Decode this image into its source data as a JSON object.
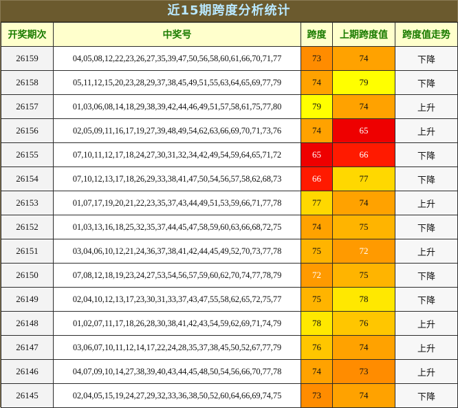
{
  "title": "近15期跨度分析统计",
  "headers": {
    "issue": "开奖期次",
    "numbers": "中奖号",
    "span": "跨度",
    "prev_span": "上期跨度值",
    "trend": "跨度值走势"
  },
  "colors": {
    "span_65": "#ee0000",
    "span_66": "#ff1a00",
    "span_72": "#ff9a00",
    "span_73": "#ff8c00",
    "span_74": "#ffa200",
    "span_75": "#ffb400",
    "span_76": "#ffc600",
    "span_77": "#ffd800",
    "span_78": "#ffe800",
    "span_79": "#ffff00"
  },
  "rows": [
    {
      "issue": "26159",
      "numbers": "04,05,08,12,22,23,26,27,35,39,47,50,56,58,60,61,66,70,71,77",
      "span": "73",
      "prev": "74",
      "trend": "下降"
    },
    {
      "issue": "26158",
      "numbers": "05,11,12,15,20,23,28,29,37,38,45,49,51,55,63,64,65,69,77,79",
      "span": "74",
      "prev": "79",
      "trend": "下降"
    },
    {
      "issue": "26157",
      "numbers": "01,03,06,08,14,18,29,38,39,42,44,46,49,51,57,58,61,75,77,80",
      "span": "79",
      "prev": "74",
      "trend": "上升"
    },
    {
      "issue": "26156",
      "numbers": "02,05,09,11,16,17,19,27,39,48,49,54,62,63,66,69,70,71,73,76",
      "span": "74",
      "prev": "65",
      "trend": "上升"
    },
    {
      "issue": "26155",
      "numbers": "07,10,11,12,17,18,24,27,30,31,32,34,42,49,54,59,64,65,71,72",
      "span": "65",
      "prev": "66",
      "trend": "下降"
    },
    {
      "issue": "26154",
      "numbers": "07,10,12,13,17,18,26,29,33,38,41,47,50,54,56,57,58,62,68,73",
      "span": "66",
      "prev": "77",
      "trend": "下降"
    },
    {
      "issue": "26153",
      "numbers": "01,07,17,19,20,21,22,23,35,37,43,44,49,51,53,59,66,71,77,78",
      "span": "77",
      "prev": "74",
      "trend": "上升"
    },
    {
      "issue": "26152",
      "numbers": "01,03,13,16,18,25,32,35,37,44,45,47,58,59,60,63,66,68,72,75",
      "span": "74",
      "prev": "75",
      "trend": "下降"
    },
    {
      "issue": "26151",
      "numbers": "03,04,06,10,12,21,24,36,37,38,41,42,44,45,49,52,70,73,77,78",
      "span": "75",
      "prev": "72",
      "trend": "上升"
    },
    {
      "issue": "26150",
      "numbers": "07,08,12,18,19,23,24,27,53,54,56,57,59,60,62,70,74,77,78,79",
      "span": "72",
      "prev": "75",
      "trend": "下降"
    },
    {
      "issue": "26149",
      "numbers": "02,04,10,12,13,17,23,30,31,33,37,43,47,55,58,62,65,72,75,77",
      "span": "75",
      "prev": "78",
      "trend": "下降"
    },
    {
      "issue": "26148",
      "numbers": "01,02,07,11,17,18,26,28,30,38,41,42,43,54,59,62,69,71,74,79",
      "span": "78",
      "prev": "76",
      "trend": "上升"
    },
    {
      "issue": "26147",
      "numbers": "03,06,07,10,11,12,14,17,22,24,28,35,37,38,45,50,52,67,77,79",
      "span": "76",
      "prev": "74",
      "trend": "上升"
    },
    {
      "issue": "26146",
      "numbers": "04,07,09,10,14,27,38,39,40,43,44,45,48,50,54,56,66,70,77,78",
      "span": "74",
      "prev": "73",
      "trend": "上升"
    },
    {
      "issue": "26145",
      "numbers": "02,04,05,15,19,24,27,29,32,33,36,38,50,52,60,64,66,69,74,75",
      "span": "73",
      "prev": "74",
      "trend": "下降"
    }
  ]
}
